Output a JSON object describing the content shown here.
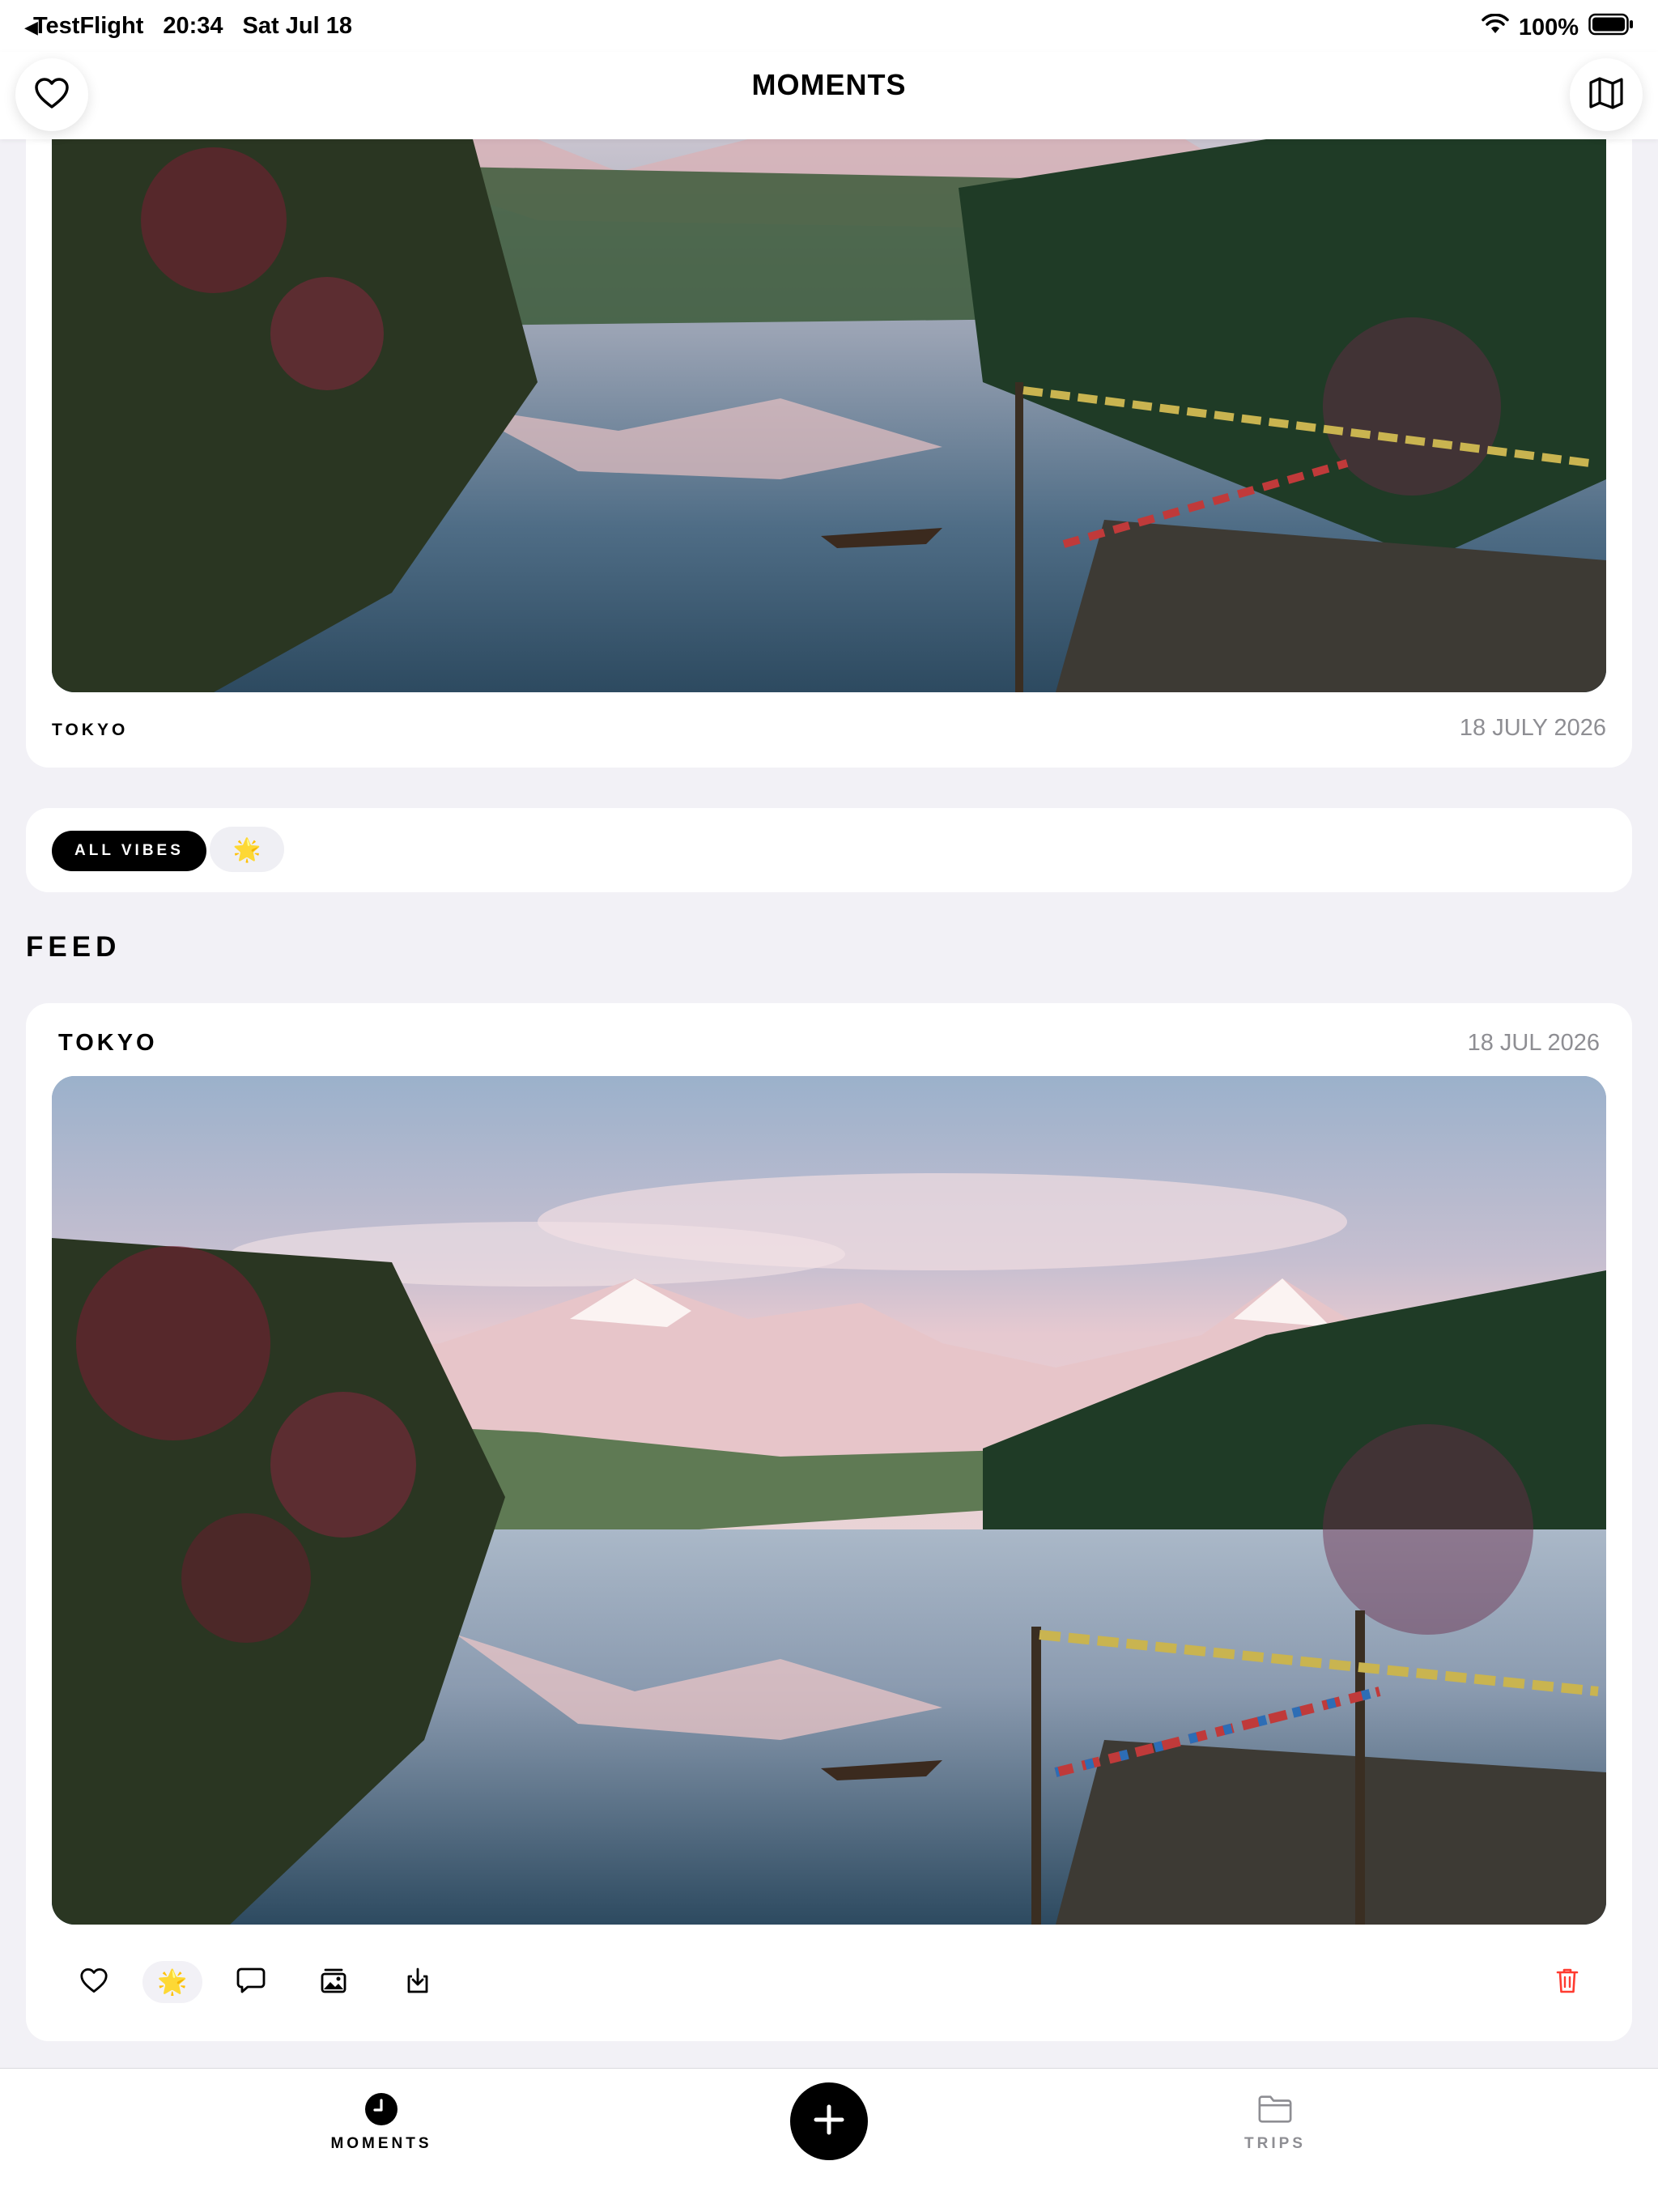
{
  "status_bar": {
    "back_app": "TestFlight",
    "time": "20:34",
    "date": "Sat Jul 18",
    "battery": "100%"
  },
  "nav": {
    "title": "MOMENTS",
    "left_icon": "heart-icon",
    "right_icon": "map-icon"
  },
  "top_moment": {
    "city": "TOKYO",
    "date": "18 JULY 2026"
  },
  "filters": {
    "active": "ALL VIBES",
    "vibe_emoji": "🌟"
  },
  "feed": {
    "section_label": "FEED",
    "items": [
      {
        "city": "TOKYO",
        "date": "18 JUL 2026",
        "vibe_emoji": "🌟",
        "actions": [
          "heart-icon",
          "vibe-badge",
          "comment-icon",
          "gallery-icon",
          "download-icon",
          "trash-icon"
        ]
      }
    ]
  },
  "tab_bar": {
    "moments_label": "MOMENTS",
    "trips_label": "TRIPS",
    "center_icon": "plus-icon"
  },
  "colors": {
    "background": "#f2f1f6",
    "accent": "#000000",
    "destructive": "#ff3b30",
    "muted": "#8e8e93"
  }
}
